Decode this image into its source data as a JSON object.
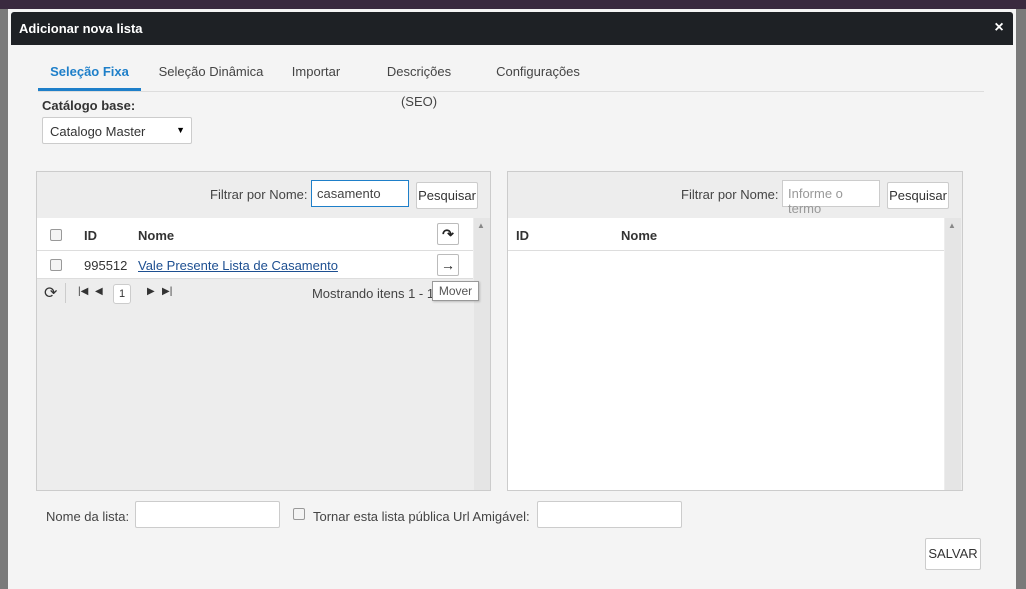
{
  "modal": {
    "title": "Adicionar nova lista",
    "close": "×"
  },
  "tabs": [
    {
      "label": "Seleção Fixa",
      "active": true
    },
    {
      "label": "Seleção Dinâmica",
      "active": false
    },
    {
      "label": "Importar",
      "active": false
    },
    {
      "label": "Descrições (SEO)",
      "active": false
    },
    {
      "label": "Configurações",
      "active": false
    }
  ],
  "catalog": {
    "label": "Catálogo base:",
    "selected": "Catalogo Master"
  },
  "left_panel": {
    "filter_label": "Filtrar por Nome:",
    "filter_value": "casamento",
    "search_button": "Pesquisar",
    "columns": {
      "id": "ID",
      "name": "Nome"
    },
    "rows": [
      {
        "id": "995512",
        "name": "Vale Presente Lista de Casamento"
      }
    ],
    "pager": {
      "page": "1",
      "info": "Mostrando itens 1 - 1 de 1"
    },
    "tooltip": "Mover"
  },
  "right_panel": {
    "filter_label": "Filtrar por Nome:",
    "filter_placeholder": "Informe o termo",
    "search_button": "Pesquisar",
    "columns": {
      "id": "ID",
      "name": "Nome"
    }
  },
  "footer": {
    "list_name_label": "Nome da lista:",
    "public_label": "Tornar esta lista pública",
    "friendly_url_label": "Url Amigável:",
    "save_button": "SALVAR"
  },
  "colors": {
    "accent": "#1e7fc9",
    "header": "#1e2125",
    "link": "#1d4f91"
  }
}
